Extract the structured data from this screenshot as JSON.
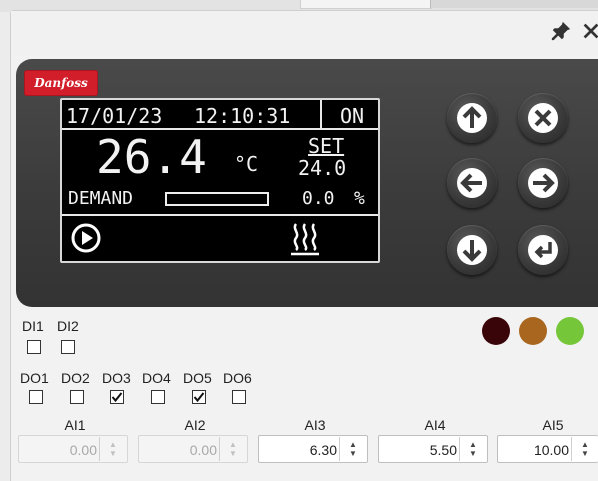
{
  "header": {
    "pin_icon": "pin-icon",
    "close_icon": "close-icon"
  },
  "brand": {
    "logo_text": "Danfoss",
    "color": "#d21e2a"
  },
  "lcd": {
    "date": "17/01/23",
    "time": "12:10:31",
    "state": "ON",
    "temperature": "26.4",
    "unit": "°C",
    "set_label": "SET",
    "set_value": "24.0",
    "demand_label": "DEMAND",
    "demand_value": "0.0",
    "demand_unit": "%",
    "demand_fraction": 0.0,
    "run_icon": "play-circle-icon",
    "heat_icon": "heating-icon"
  },
  "keypad": [
    {
      "name": "up",
      "icon": "arrow-up-icon"
    },
    {
      "name": "cancel",
      "icon": "close-icon"
    },
    {
      "name": "left",
      "icon": "arrow-left-icon"
    },
    {
      "name": "right",
      "icon": "arrow-right-icon"
    },
    {
      "name": "down",
      "icon": "arrow-down-icon"
    },
    {
      "name": "enter",
      "icon": "enter-icon"
    }
  ],
  "leds": [
    {
      "name": "alarm",
      "color": "#3a0509"
    },
    {
      "name": "warning",
      "color": "#a9661f"
    },
    {
      "name": "ok",
      "color": "#76c63a"
    }
  ],
  "digital_inputs": [
    {
      "label": "DI1",
      "checked": false
    },
    {
      "label": "DI2",
      "checked": false
    }
  ],
  "digital_outputs": [
    {
      "label": "DO1",
      "checked": false
    },
    {
      "label": "DO2",
      "checked": false
    },
    {
      "label": "DO3",
      "checked": true
    },
    {
      "label": "DO4",
      "checked": false
    },
    {
      "label": "DO5",
      "checked": true
    },
    {
      "label": "DO6",
      "checked": false
    }
  ],
  "analog_inputs": [
    {
      "label": "AI1",
      "value": "0.00",
      "disabled": true
    },
    {
      "label": "AI2",
      "value": "0.00",
      "disabled": true
    },
    {
      "label": "AI3",
      "value": "6.30",
      "disabled": false
    },
    {
      "label": "AI4",
      "value": "5.50",
      "disabled": false
    },
    {
      "label": "AI5",
      "value": "10.00",
      "disabled": false
    }
  ]
}
